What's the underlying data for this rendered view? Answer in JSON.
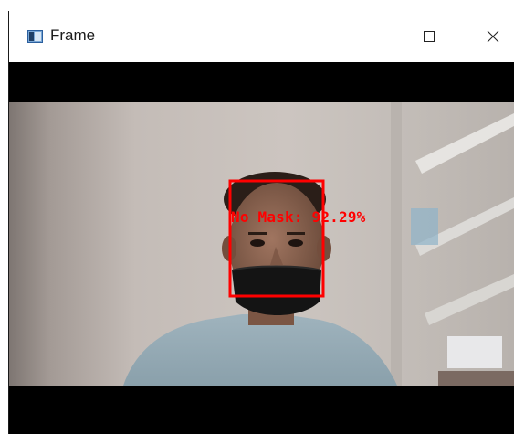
{
  "window": {
    "title": "Frame",
    "icons": {
      "app": "opencv-window-icon",
      "minimize": "minimize-icon",
      "maximize": "maximize-icon",
      "close": "close-icon"
    }
  },
  "detection": {
    "label": "No Mask: 92.29%",
    "box_color": "#ff0000"
  }
}
